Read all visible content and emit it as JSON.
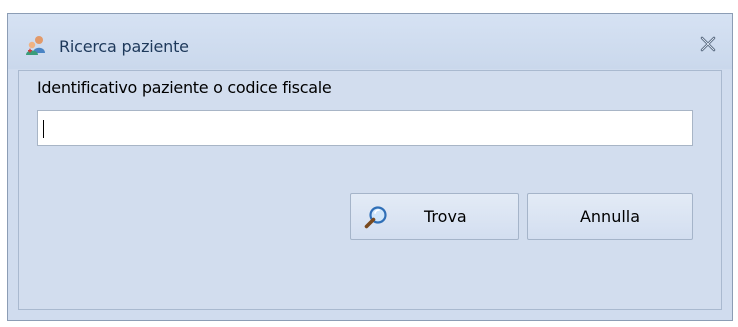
{
  "dialog": {
    "title": "Ricerca paziente",
    "title_icon": "patient-search-icon",
    "close_icon": "close-icon"
  },
  "form": {
    "label": "Identificativo paziente o codice fiscale",
    "input_value": ""
  },
  "buttons": {
    "search_label": "Trova",
    "search_icon": "magnifier-icon",
    "cancel_label": "Annulla"
  },
  "colors": {
    "window_bg": "#d0dcee",
    "title_text": "#1e395b",
    "border": "#8c9db5"
  }
}
